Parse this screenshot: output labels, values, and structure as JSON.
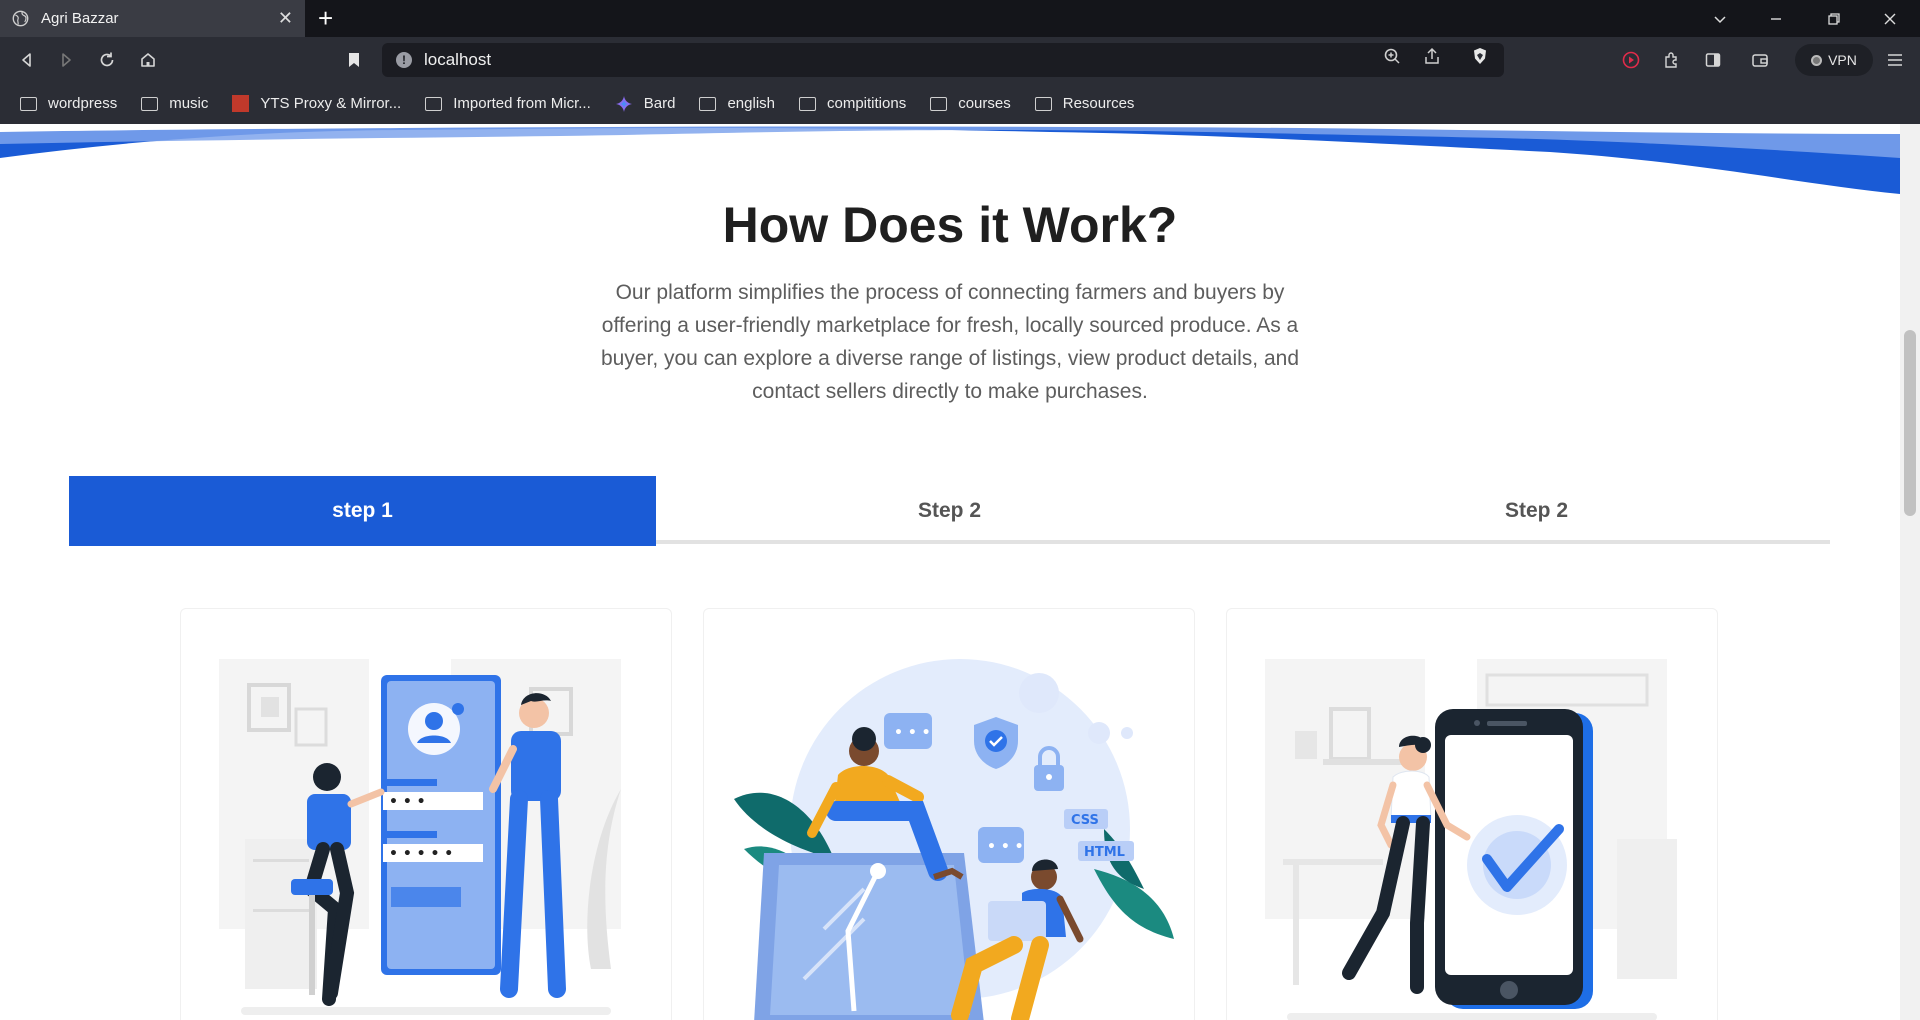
{
  "browser": {
    "tab_title": "Agri Bazzar",
    "url": "localhost",
    "vpn_label": "VPN",
    "bookmarks": [
      {
        "label": "wordpress",
        "icon": "folder-icon"
      },
      {
        "label": "music",
        "icon": "folder-icon"
      },
      {
        "label": "YTS Proxy & Mirror...",
        "icon": "yts-favicon"
      },
      {
        "label": "Imported from Micr...",
        "icon": "folder-icon"
      },
      {
        "label": "Bard",
        "icon": "bard-sparkle-icon"
      },
      {
        "label": "english",
        "icon": "folder-icon"
      },
      {
        "label": "compititions",
        "icon": "folder-icon"
      },
      {
        "label": "courses",
        "icon": "folder-icon"
      },
      {
        "label": "Resources",
        "icon": "folder-icon"
      }
    ]
  },
  "section": {
    "title": "How Does it Work?",
    "description": "Our platform simplifies the process of connecting farmers and buyers by offering a user-friendly marketplace for fresh, locally sourced produce. As a buyer, you can explore a diverse range of listings, view product details, and contact sellers directly to make purchases."
  },
  "tabs": [
    {
      "label": "step 1",
      "active": true
    },
    {
      "label": "Step 2",
      "active": false
    },
    {
      "label": "Step 2",
      "active": false
    }
  ],
  "cards": [
    {
      "illustration": "sign-up-login-illustration"
    },
    {
      "illustration": "secure-chat-illustration"
    },
    {
      "illustration": "phone-verified-illustration"
    }
  ],
  "colors": {
    "accent": "#1a5bd6",
    "tab_inactive_text": "#555555",
    "chrome_dark": "#2b2d35"
  }
}
